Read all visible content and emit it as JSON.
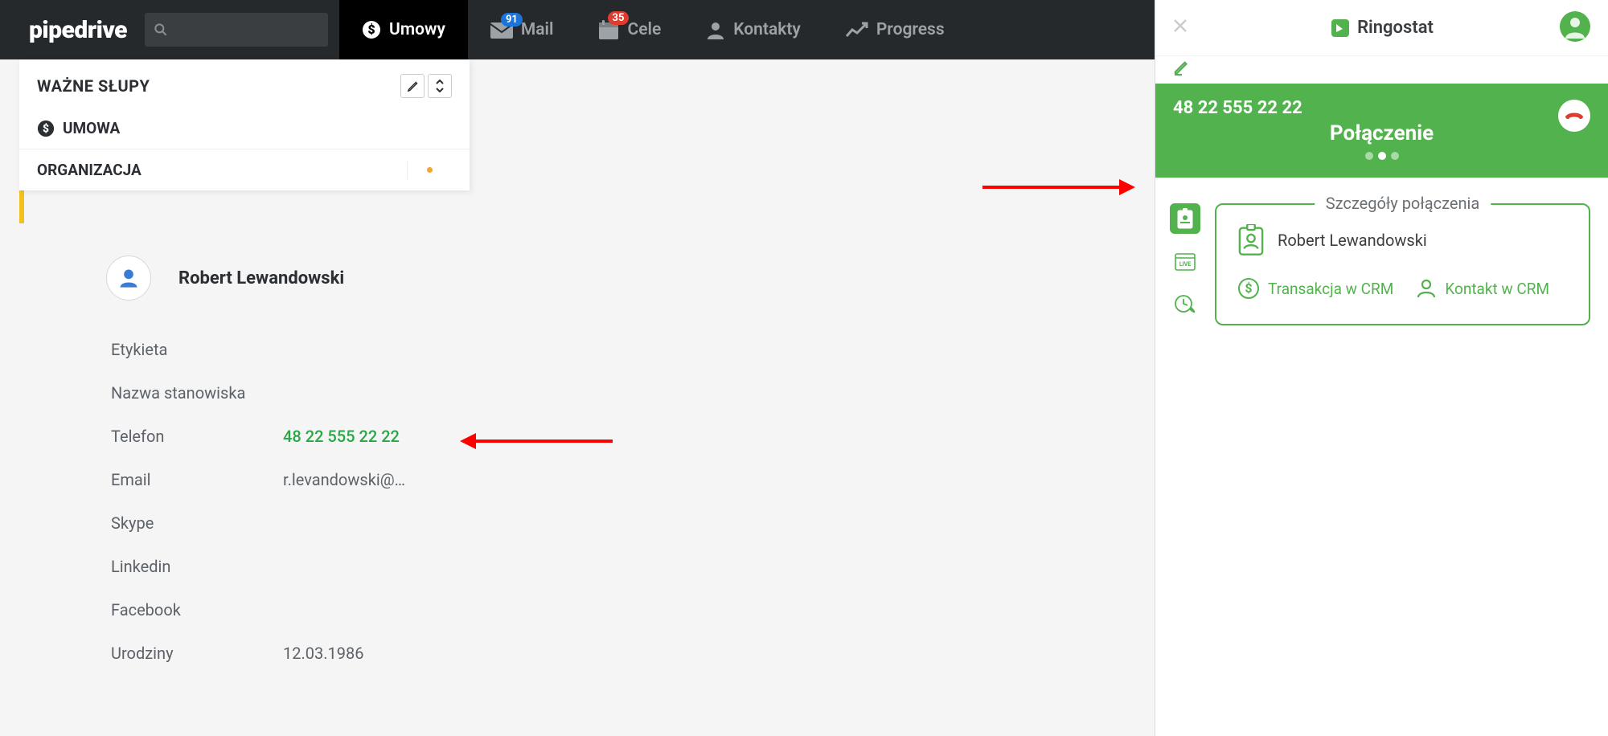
{
  "brand": "pipedrive",
  "nav": {
    "umowy": "Umowy",
    "mail": "Mail",
    "mail_badge": "91",
    "cele": "Cele",
    "cele_badge": "35",
    "kontakty": "Kontakty",
    "progress": "Progress"
  },
  "left_panel": {
    "title": "WAŻNE SŁUPY",
    "row_deal": "UMOWA",
    "row_org": "ORGANIZACJA"
  },
  "contact": {
    "name": "Robert Lewandowski",
    "fields": {
      "etykieta": {
        "label": "Etykieta",
        "value": ""
      },
      "stanowisko": {
        "label": "Nazwa stanowiska",
        "value": ""
      },
      "telefon": {
        "label": "Telefon",
        "value": "48 22 555 22 22"
      },
      "email": {
        "label": "Email",
        "value": "r.levandowski@…"
      },
      "skype": {
        "label": "Skype",
        "value": ""
      },
      "linkedin": {
        "label": "Linkedin",
        "value": ""
      },
      "facebook": {
        "label": "Facebook",
        "value": ""
      },
      "urodziny": {
        "label": "Urodziny",
        "value": "12.03.1986"
      }
    }
  },
  "ringostat": {
    "brand": "Ringostat",
    "phone": "48 22 555 22 22",
    "status": "Połączenie",
    "details_title": "Szczegóły połączenia",
    "contact_name": "Robert Lewandowski",
    "link_trans": "Transakcja w CRM",
    "link_contact": "Kontakt w CRM"
  }
}
